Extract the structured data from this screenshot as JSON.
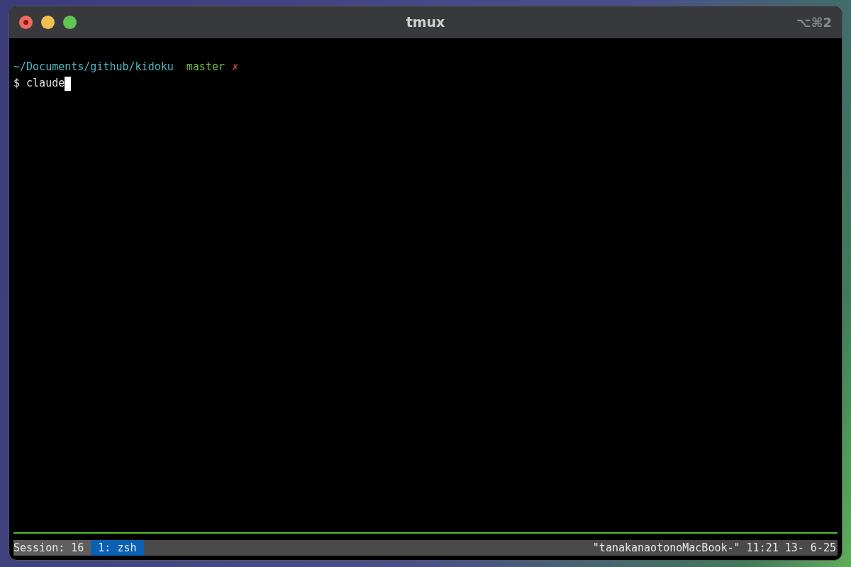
{
  "window": {
    "title": "tmux",
    "shortcut": "⌥⌘2"
  },
  "prompt": {
    "path": "~/Documents/github/kidoku",
    "branch": "master",
    "dirty_mark": "✗",
    "symbol": "$",
    "command": "claude"
  },
  "status_bar": {
    "session": "Session: 16",
    "windows": [
      {
        "label": "1: zsh",
        "selected": true
      }
    ],
    "right": "\"tanakanaotonoMacBook-\" 11:21 13- 6-25"
  }
}
